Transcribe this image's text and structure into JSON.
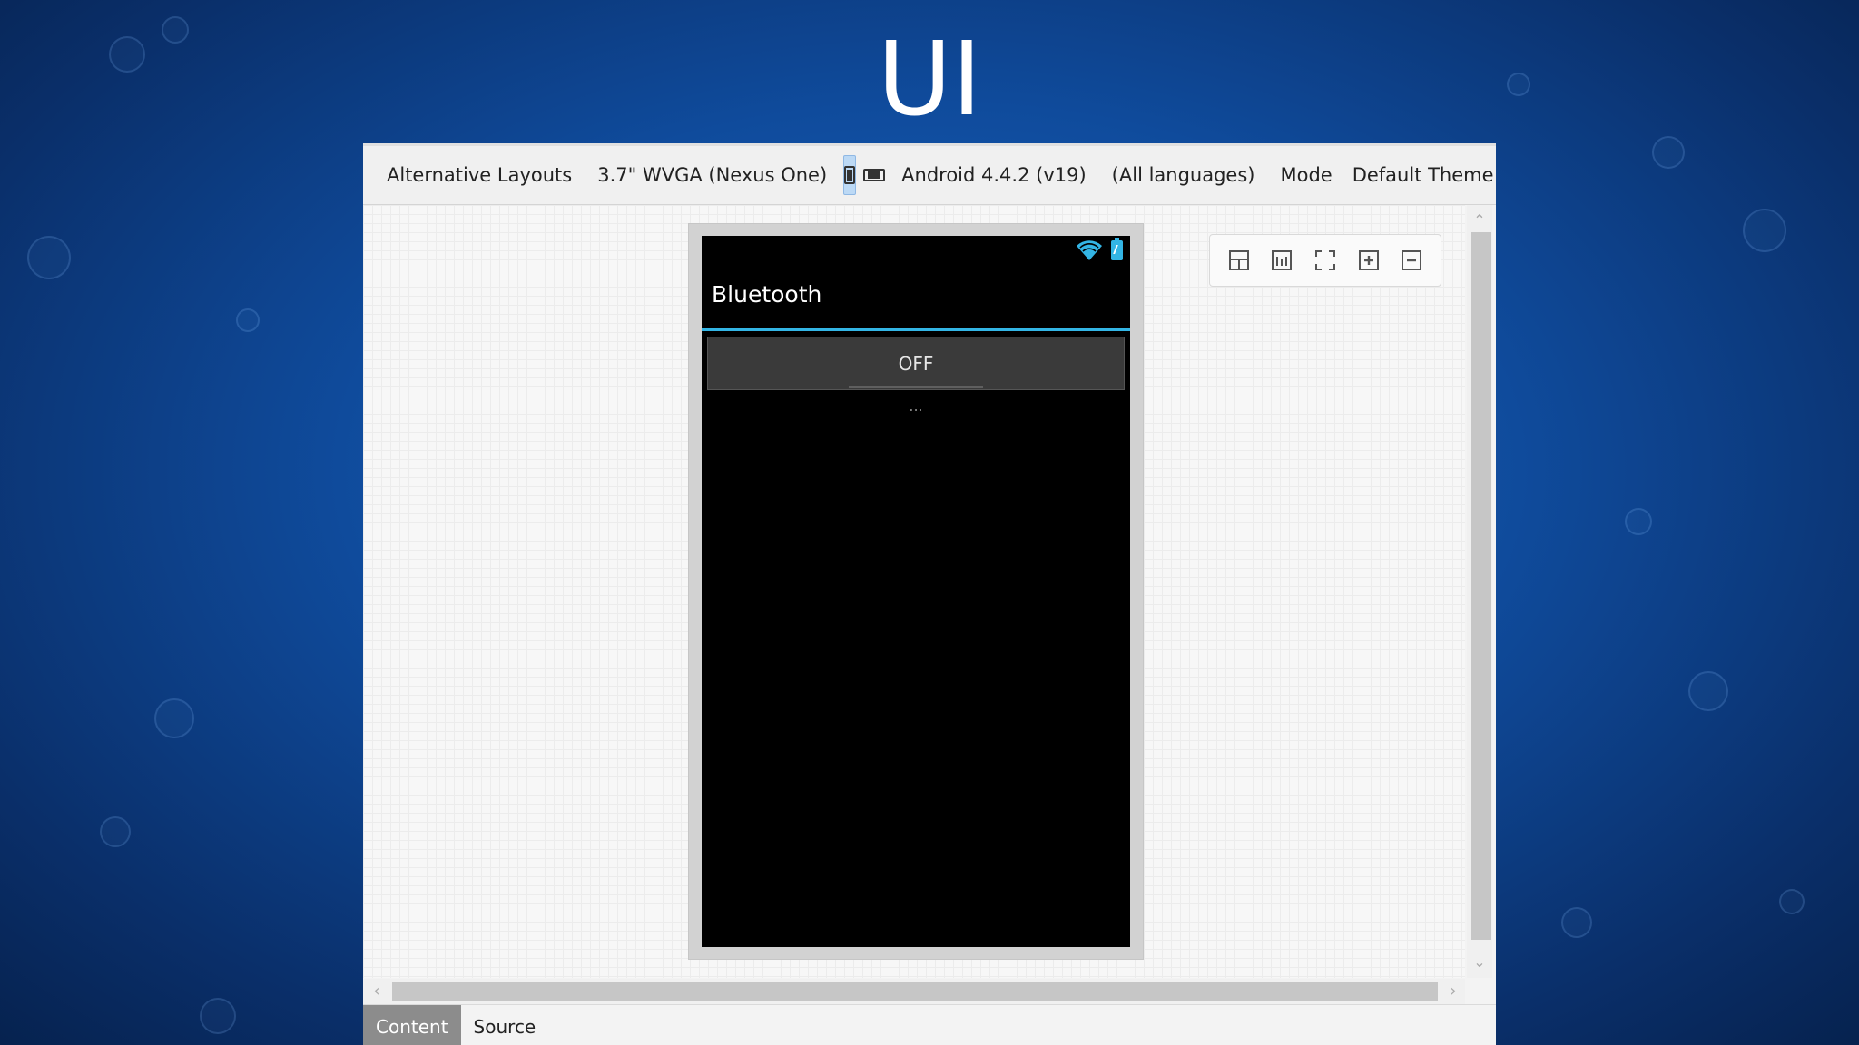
{
  "slide": {
    "title": "UI"
  },
  "toolbar": {
    "alternative_layouts": "Alternative Layouts",
    "device": "3.7\" WVGA (Nexus One)",
    "android_version": "Android 4.4.2 (v19)",
    "languages": "(All languages)",
    "mode": "Mode",
    "theme": "Default Theme"
  },
  "phone": {
    "app_title": "Bluetooth",
    "toggle_label": "OFF",
    "status_text": "...",
    "accent_color": "#33b5e5"
  },
  "bottom_tabs": [
    {
      "label": "Content",
      "active": true
    },
    {
      "label": "Source",
      "active": false
    }
  ]
}
